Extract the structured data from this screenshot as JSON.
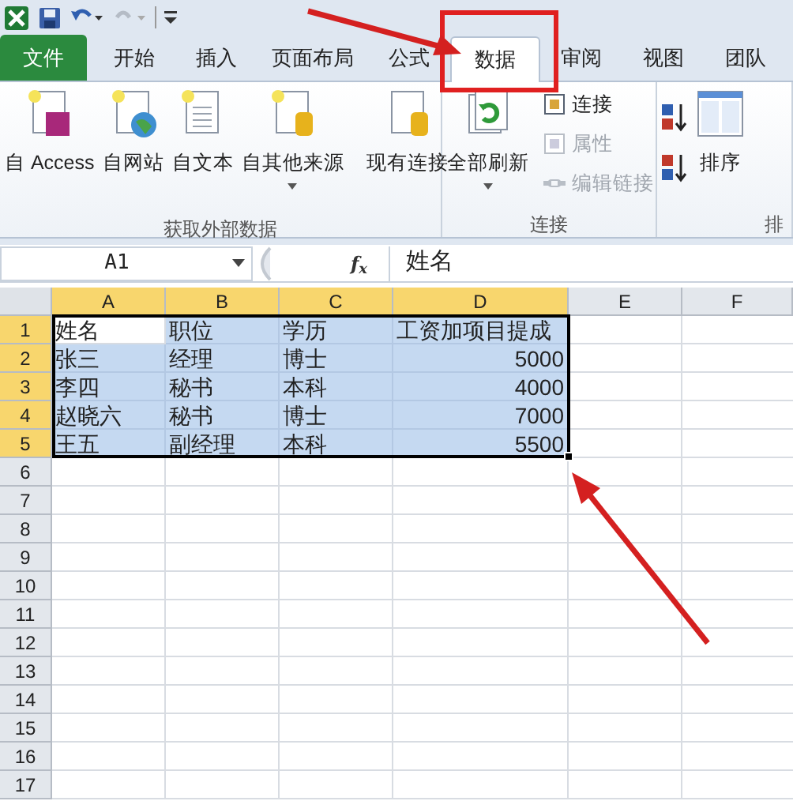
{
  "tabs": [
    {
      "label": "文件",
      "kind": "file",
      "selected": false
    },
    {
      "label": "开始",
      "kind": "tab",
      "selected": false
    },
    {
      "label": "插入",
      "kind": "tab",
      "selected": false
    },
    {
      "label": "页面布局",
      "kind": "tab",
      "selected": false
    },
    {
      "label": "公式",
      "kind": "tab",
      "selected": false
    },
    {
      "label": "数据",
      "kind": "tab",
      "selected": true
    },
    {
      "label": "审阅",
      "kind": "tab",
      "selected": false
    },
    {
      "label": "视图",
      "kind": "tab",
      "selected": false
    },
    {
      "label": "团队",
      "kind": "tab",
      "selected": false
    }
  ],
  "ribbon": {
    "groups": [
      {
        "label": "获取外部数据",
        "buttons": [
          {
            "label": "自 Access",
            "kind": "large",
            "dropdown": false,
            "disabled": false
          },
          {
            "label": "自网站",
            "kind": "large",
            "dropdown": false,
            "disabled": false
          },
          {
            "label": "自文本",
            "kind": "large",
            "dropdown": false,
            "disabled": false
          },
          {
            "label": "自其他来源",
            "kind": "large",
            "dropdown": true,
            "disabled": false
          },
          {
            "label": "现有连接",
            "kind": "large",
            "dropdown": false,
            "disabled": false
          }
        ]
      },
      {
        "label": "连接",
        "buttons": [
          {
            "label": "全部刷新",
            "kind": "large",
            "dropdown": true,
            "disabled": false
          },
          {
            "label": "连接",
            "kind": "small",
            "dropdown": false,
            "disabled": false
          },
          {
            "label": "属性",
            "kind": "small",
            "dropdown": false,
            "disabled": true
          },
          {
            "label": "编辑链接",
            "kind": "small",
            "dropdown": false,
            "disabled": true
          }
        ]
      },
      {
        "label": "排",
        "buttons": [
          {
            "kind": "sort-asc",
            "disabled": false
          },
          {
            "kind": "sort-desc",
            "disabled": false
          },
          {
            "label": "排序",
            "kind": "large",
            "dropdown": false,
            "disabled": false
          }
        ]
      }
    ]
  },
  "formula_bar": {
    "name_box": "A1",
    "fx": "f$_{x}$",
    "formula": "姓名"
  },
  "sheet": {
    "columns": [
      {
        "label": "A",
        "selected": true
      },
      {
        "label": "B",
        "selected": true
      },
      {
        "label": "C",
        "selected": true
      },
      {
        "label": "D",
        "selected": true
      },
      {
        "label": "E",
        "selected": false
      },
      {
        "label": "F",
        "selected": false
      }
    ],
    "rows": [
      {
        "label": "1",
        "selected": true,
        "cells": [
          {
            "text": "姓名",
            "kind": "text",
            "selected": true,
            "active": true
          },
          {
            "text": "职位",
            "kind": "text",
            "selected": true,
            "active": false
          },
          {
            "text": "学历",
            "kind": "text",
            "selected": true,
            "active": false
          },
          {
            "text": "工资加项目提成",
            "kind": "text",
            "selected": true,
            "active": false
          }
        ]
      },
      {
        "label": "2",
        "selected": true,
        "cells": [
          {
            "text": "张三",
            "kind": "text",
            "selected": true,
            "active": false
          },
          {
            "text": "经理",
            "kind": "text",
            "selected": true,
            "active": false
          },
          {
            "text": "博士",
            "kind": "text",
            "selected": true,
            "active": false
          },
          {
            "text": "5000",
            "kind": "number",
            "selected": true,
            "active": false
          }
        ]
      },
      {
        "label": "3",
        "selected": true,
        "cells": [
          {
            "text": "李四",
            "kind": "text",
            "selected": true,
            "active": false
          },
          {
            "text": "秘书",
            "kind": "text",
            "selected": true,
            "active": false
          },
          {
            "text": "本科",
            "kind": "text",
            "selected": true,
            "active": false
          },
          {
            "text": "4000",
            "kind": "number",
            "selected": true,
            "active": false
          }
        ]
      },
      {
        "label": "4",
        "selected": true,
        "cells": [
          {
            "text": "赵晓六",
            "kind": "text",
            "selected": true,
            "active": false
          },
          {
            "text": "秘书",
            "kind": "text",
            "selected": true,
            "active": false
          },
          {
            "text": "博士",
            "kind": "text",
            "selected": true,
            "active": false
          },
          {
            "text": "7000",
            "kind": "number",
            "selected": true,
            "active": false
          }
        ]
      },
      {
        "label": "5",
        "selected": true,
        "cells": [
          {
            "text": "王五",
            "kind": "text",
            "selected": true,
            "active": false
          },
          {
            "text": "副经理",
            "kind": "text",
            "selected": true,
            "active": false
          },
          {
            "text": "本科",
            "kind": "text",
            "selected": true,
            "active": false
          },
          {
            "text": "5500",
            "kind": "number",
            "selected": true,
            "active": false
          }
        ]
      },
      {
        "label": "6",
        "selected": false
      },
      {
        "label": "7",
        "selected": false
      },
      {
        "label": "8",
        "selected": false
      },
      {
        "label": "9",
        "selected": false
      },
      {
        "label": "10",
        "selected": false
      },
      {
        "label": "11",
        "selected": false
      },
      {
        "label": "12",
        "selected": false
      },
      {
        "label": "13",
        "selected": false
      },
      {
        "label": "14",
        "selected": false
      },
      {
        "label": "15",
        "selected": false
      },
      {
        "label": "16",
        "selected": false
      },
      {
        "label": "17",
        "selected": false
      }
    ]
  }
}
